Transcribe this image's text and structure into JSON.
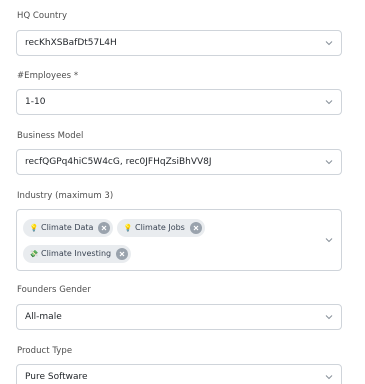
{
  "fields": {
    "hq_country": {
      "label": "HQ Country",
      "value": "recKhXSBafDt57L4H"
    },
    "employees": {
      "label": "#Employees *",
      "value": "1-10"
    },
    "business_model": {
      "label": "Business Model",
      "value": "recfQGPq4hiC5W4cG, rec0JFHqZsiBhVV8J"
    },
    "industry": {
      "label": "Industry (maximum 3)",
      "chips": [
        {
          "emoji": "💡",
          "label": "Climate Data"
        },
        {
          "emoji": "💡",
          "label": "Climate Jobs"
        },
        {
          "emoji": "💸",
          "label": "Climate Investing"
        }
      ]
    },
    "founders_gender": {
      "label": "Founders Gender",
      "value": "All-male"
    },
    "product_type": {
      "label": "Product Type",
      "value": "Pure Software"
    }
  },
  "icons": {
    "chevron": "chevron-down-icon",
    "remove": "close-circle-icon"
  },
  "colors": {
    "border": "#cfd4da",
    "chip_bg": "#e9ecef",
    "chip_text": "#3a4453",
    "label": "#4d4d4d"
  }
}
